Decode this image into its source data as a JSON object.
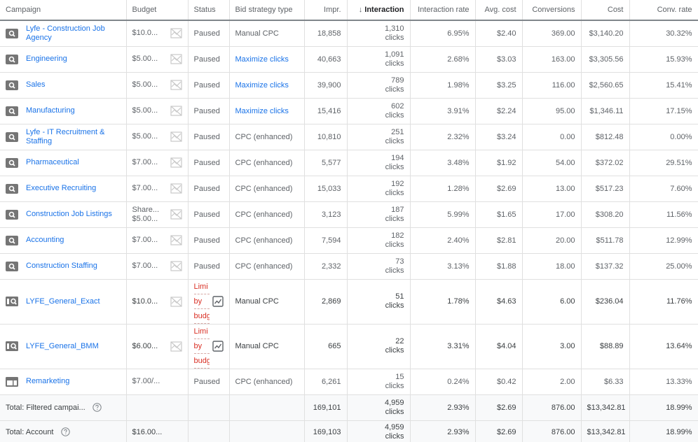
{
  "columns": [
    {
      "key": "campaign",
      "label": "Campaign"
    },
    {
      "key": "budget",
      "label": "Budget"
    },
    {
      "key": "status",
      "label": "Status"
    },
    {
      "key": "bid",
      "label": "Bid strategy type"
    },
    {
      "key": "impr",
      "label": "Impr."
    },
    {
      "key": "interaction",
      "label": "Interaction",
      "sort": "descending",
      "sort_icon": "arrow-down-icon"
    },
    {
      "key": "rate",
      "label": "Interaction rate"
    },
    {
      "key": "avg",
      "label": "Avg. cost"
    },
    {
      "key": "conv",
      "label": "Conversions"
    },
    {
      "key": "cost",
      "label": "Cost"
    },
    {
      "key": "cr",
      "label": "Conv. rate"
    }
  ],
  "rows": [
    {
      "icon": "search-campaign-icon",
      "campaign": "Lyfe - Construction Job Agency",
      "budget": "$10.0...",
      "status": "Paused",
      "bid": "Manual CPC",
      "bid_link": false,
      "impr": "18,858",
      "interaction": "1,310",
      "interaction_unit": "clicks",
      "rate": "6.95%",
      "avg": "$2.40",
      "conv": "369.00",
      "cost": "$3,140.20",
      "cr": "30.32%"
    },
    {
      "icon": "search-campaign-icon",
      "campaign": "Engineering",
      "budget": "$5.00...",
      "status": "Paused",
      "bid": "Maximize clicks",
      "bid_link": true,
      "impr": "40,663",
      "interaction": "1,091",
      "interaction_unit": "clicks",
      "rate": "2.68%",
      "avg": "$3.03",
      "conv": "163.00",
      "cost": "$3,305.56",
      "cr": "15.93%"
    },
    {
      "icon": "search-campaign-icon",
      "campaign": "Sales",
      "budget": "$5.00...",
      "status": "Paused",
      "bid": "Maximize clicks",
      "bid_link": true,
      "impr": "39,900",
      "interaction": "789",
      "interaction_unit": "clicks",
      "rate": "1.98%",
      "avg": "$3.25",
      "conv": "116.00",
      "cost": "$2,560.65",
      "cr": "15.41%"
    },
    {
      "icon": "search-campaign-icon",
      "campaign": "Manufacturing",
      "budget": "$5.00...",
      "status": "Paused",
      "bid": "Maximize clicks",
      "bid_link": true,
      "impr": "15,416",
      "interaction": "602",
      "interaction_unit": "clicks",
      "rate": "3.91%",
      "avg": "$2.24",
      "conv": "95.00",
      "cost": "$1,346.11",
      "cr": "17.15%"
    },
    {
      "icon": "search-campaign-icon",
      "campaign": "Lyfe - IT Recruitment & Staffing",
      "budget": "$5.00...",
      "status": "Paused",
      "bid": "CPC (enhanced)",
      "bid_link": false,
      "impr": "10,810",
      "interaction": "251",
      "interaction_unit": "clicks",
      "rate": "2.32%",
      "avg": "$3.24",
      "conv": "0.00",
      "cost": "$812.48",
      "cr": "0.00%"
    },
    {
      "icon": "search-campaign-icon",
      "campaign": "Pharmaceutical",
      "budget": "$7.00...",
      "status": "Paused",
      "bid": "CPC (enhanced)",
      "bid_link": false,
      "impr": "5,577",
      "interaction": "194",
      "interaction_unit": "clicks",
      "rate": "3.48%",
      "avg": "$1.92",
      "conv": "54.00",
      "cost": "$372.02",
      "cr": "29.51%"
    },
    {
      "icon": "search-campaign-icon",
      "campaign": "Executive Recruiting",
      "budget": "$7.00...",
      "status": "Paused",
      "bid": "CPC (enhanced)",
      "bid_link": false,
      "impr": "15,033",
      "interaction": "192",
      "interaction_unit": "clicks",
      "rate": "1.28%",
      "avg": "$2.69",
      "conv": "13.00",
      "cost": "$517.23",
      "cr": "7.60%"
    },
    {
      "icon": "search-campaign-icon",
      "campaign": "Construction Job Listings",
      "budget": "Share...",
      "budget2": "$5.00...",
      "status": "Paused",
      "bid": "CPC (enhanced)",
      "bid_link": false,
      "impr": "3,123",
      "interaction": "187",
      "interaction_unit": "clicks",
      "rate": "5.99%",
      "avg": "$1.65",
      "conv": "17.00",
      "cost": "$308.20",
      "cr": "11.56%"
    },
    {
      "icon": "search-campaign-icon",
      "campaign": "Accounting",
      "budget": "$7.00...",
      "status": "Paused",
      "bid": "CPC (enhanced)",
      "bid_link": false,
      "impr": "7,594",
      "interaction": "182",
      "interaction_unit": "clicks",
      "rate": "2.40%",
      "avg": "$2.81",
      "conv": "20.00",
      "cost": "$511.78",
      "cr": "12.99%"
    },
    {
      "icon": "search-campaign-icon",
      "campaign": "Construction Staffing",
      "budget": "$7.00...",
      "status": "Paused",
      "bid": "CPC (enhanced)",
      "bid_link": false,
      "impr": "2,332",
      "interaction": "73",
      "interaction_unit": "clicks",
      "rate": "3.13%",
      "avg": "$1.88",
      "conv": "18.00",
      "cost": "$137.32",
      "cr": "25.00%"
    },
    {
      "icon": "search-partners-campaign-icon",
      "campaign": "LYFE_General_Exact",
      "budget": "$10.0...",
      "status_limited": [
        "Limi",
        "by",
        "budg"
      ],
      "status_tooltip": "Limited by budget",
      "bid": "Manual CPC",
      "bid_link": false,
      "impr": "2,869",
      "interaction": "51",
      "interaction_unit": "clicks",
      "rate": "1.78%",
      "avg": "$4.63",
      "conv": "6.00",
      "cost": "$236.04",
      "cr": "11.76%",
      "active": true
    },
    {
      "icon": "search-partners-campaign-icon",
      "campaign": "LYFE_General_BMM",
      "budget": "$6.00...",
      "status_limited": [
        "Limi",
        "by",
        "budg"
      ],
      "status_tooltip": "Limited by budget",
      "bid": "Manual CPC",
      "bid_link": false,
      "impr": "665",
      "interaction": "22",
      "interaction_unit": "clicks",
      "rate": "3.31%",
      "avg": "$4.04",
      "conv": "3.00",
      "cost": "$88.89",
      "cr": "13.64%",
      "active": true
    },
    {
      "icon": "display-campaign-icon",
      "campaign": "Remarketing",
      "budget": "$7.00/...",
      "status": "Paused",
      "bid": "CPC (enhanced)",
      "bid_link": false,
      "impr": "6,261",
      "interaction": "15",
      "interaction_unit": "clicks",
      "rate": "0.24%",
      "avg": "$0.42",
      "conv": "2.00",
      "cost": "$6.33",
      "cr": "13.33%",
      "no_budget_icon": true
    }
  ],
  "totals": [
    {
      "label": "Total: Filtered campai...",
      "budget": "",
      "impr": "169,101",
      "interaction": "4,959",
      "interaction_unit": "clicks",
      "rate": "2.93%",
      "avg": "$2.69",
      "conv": "876.00",
      "cost": "$13,342.81",
      "cr": "18.99%"
    },
    {
      "label": "Total: Account",
      "budget": "$16.00...",
      "impr": "169,103",
      "interaction": "4,959",
      "interaction_unit": "clicks",
      "rate": "2.93%",
      "avg": "$2.69",
      "conv": "876.00",
      "cost": "$13,342.81",
      "cr": "18.99%"
    }
  ]
}
